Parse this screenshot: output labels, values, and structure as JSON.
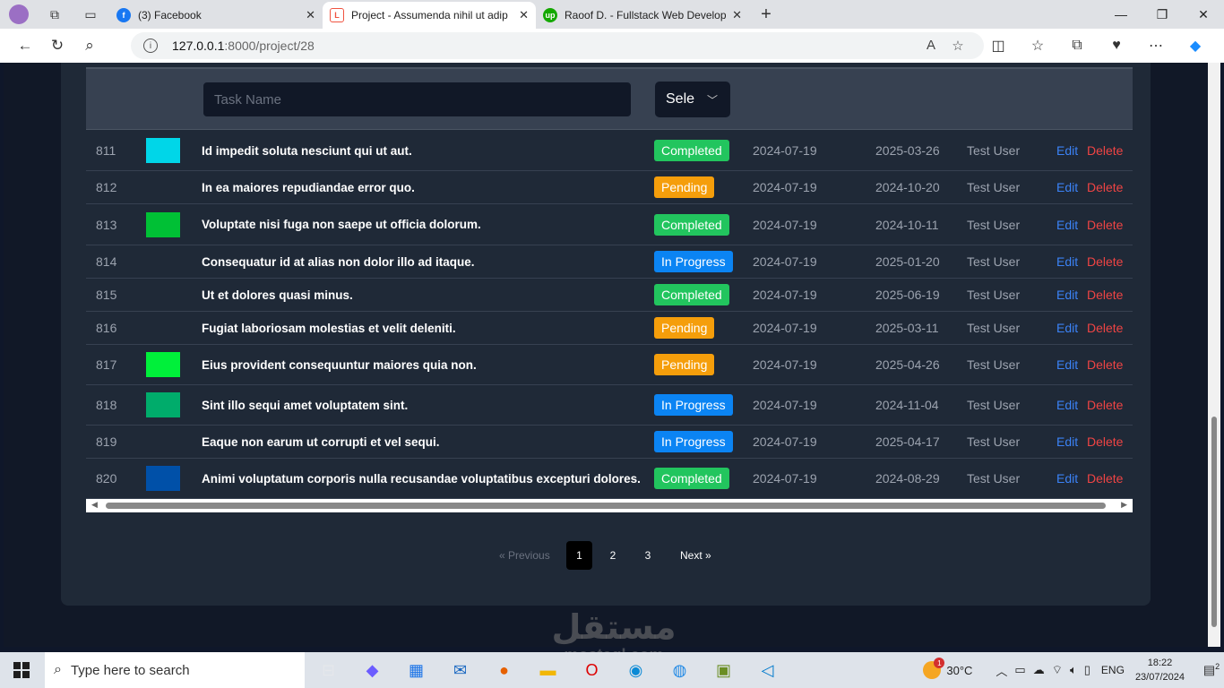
{
  "browser": {
    "tabs": [
      {
        "label": "(3) Facebook",
        "favicon": "facebook-icon",
        "color": "#1877f2",
        "active": false
      },
      {
        "label": "Project - Assumenda nihil ut adip",
        "favicon": "laravel-icon",
        "color": "#f05340",
        "active": true
      },
      {
        "label": "Raoof D. - Fullstack Web Develop",
        "favicon": "upwork-icon",
        "color": "#14a800",
        "active": false
      }
    ],
    "url_host": "127.0.0.1",
    "url_path": ":8000/project/28"
  },
  "filters": {
    "task_name_placeholder": "Task Name",
    "status_select": "Sele"
  },
  "status_colors": {
    "Completed": "#22c55e",
    "Pending": "#f59e0b",
    "In Progress": "#0b84f3"
  },
  "tasks": [
    {
      "id": "811",
      "image_color": "#00d6e8",
      "name": "Id impedit soluta nesciunt qui ut aut.",
      "status": "Completed",
      "created": "2024-07-19",
      "due": "2025-03-26",
      "user": "Test User",
      "edit": "Edit",
      "delete": "Delete"
    },
    {
      "id": "812",
      "image_color": null,
      "name": "In ea maiores repudiandae error quo.",
      "status": "Pending",
      "created": "2024-07-19",
      "due": "2024-10-20",
      "user": "Test User",
      "edit": "Edit",
      "delete": "Delete"
    },
    {
      "id": "813",
      "image_color": "#00c035",
      "name": "Voluptate nisi fuga non saepe ut officia dolorum.",
      "status": "Completed",
      "created": "2024-07-19",
      "due": "2024-10-11",
      "user": "Test User",
      "edit": "Edit",
      "delete": "Delete"
    },
    {
      "id": "814",
      "image_color": null,
      "name": "Consequatur id at alias non dolor illo ad itaque.",
      "status": "In Progress",
      "created": "2024-07-19",
      "due": "2025-01-20",
      "user": "Test User",
      "edit": "Edit",
      "delete": "Delete"
    },
    {
      "id": "815",
      "image_color": null,
      "name": "Ut et dolores quasi minus.",
      "status": "Completed",
      "created": "2024-07-19",
      "due": "2025-06-19",
      "user": "Test User",
      "edit": "Edit",
      "delete": "Delete"
    },
    {
      "id": "816",
      "image_color": null,
      "name": "Fugiat laboriosam molestias et velit deleniti.",
      "status": "Pending",
      "created": "2024-07-19",
      "due": "2025-03-11",
      "user": "Test User",
      "edit": "Edit",
      "delete": "Delete"
    },
    {
      "id": "817",
      "image_color": "#00f03a",
      "name": "Eius provident consequuntur maiores quia non.",
      "status": "Pending",
      "created": "2024-07-19",
      "due": "2025-04-26",
      "user": "Test User",
      "edit": "Edit",
      "delete": "Delete"
    },
    {
      "id": "818",
      "image_color": "#00ac6b",
      "name": "Sint illo sequi amet voluptatem sint.",
      "status": "In Progress",
      "created": "2024-07-19",
      "due": "2024-11-04",
      "user": "Test User",
      "edit": "Edit",
      "delete": "Delete"
    },
    {
      "id": "819",
      "image_color": null,
      "name": "Eaque non earum ut corrupti et vel sequi.",
      "status": "In Progress",
      "created": "2024-07-19",
      "due": "2025-04-17",
      "user": "Test User",
      "edit": "Edit",
      "delete": "Delete"
    },
    {
      "id": "820",
      "image_color": "#0050a8",
      "name": "Animi voluptatum corporis nulla recusandae voluptatibus excepturi dolores.",
      "status": "Completed",
      "created": "2024-07-19",
      "due": "2024-08-29",
      "user": "Test User",
      "edit": "Edit",
      "delete": "Delete"
    }
  ],
  "pagination": {
    "prev": "« Previous",
    "pages": [
      "1",
      "2",
      "3"
    ],
    "current": "1",
    "next": "Next »"
  },
  "watermark": {
    "arabic": "مستقل",
    "latin": "mostaql.com"
  },
  "taskbar": {
    "search_placeholder": "Type here to search",
    "temperature": "30°C",
    "language": "ENG",
    "time": "18:22",
    "date": "23/07/2024",
    "notification_count": "2",
    "weather_badge": "1"
  }
}
